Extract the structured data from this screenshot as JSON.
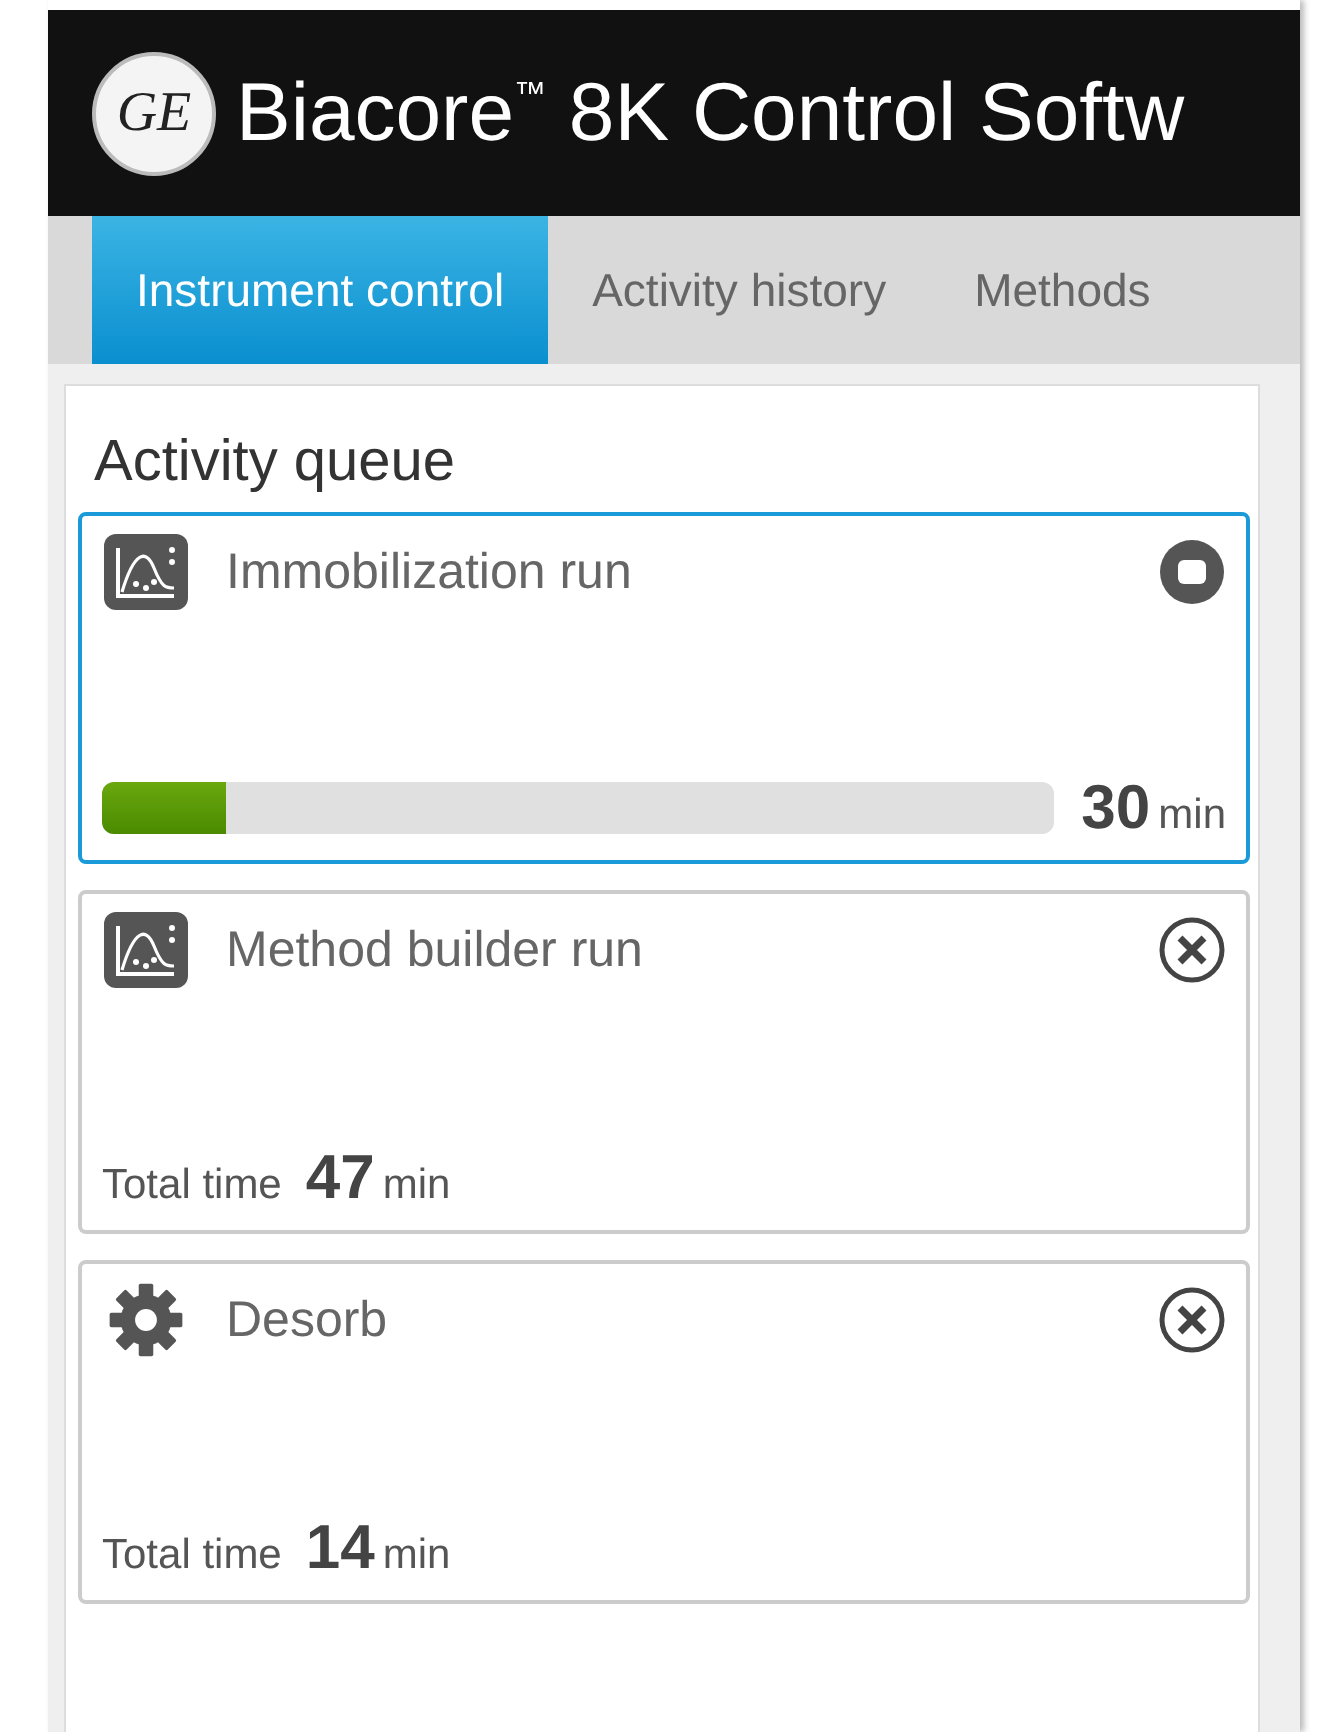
{
  "header": {
    "logo": "GE",
    "title": "Biacore$^{™}$ 8K Control Softw"
  },
  "tabs": [
    {
      "label": "Instrument control",
      "selected": true
    },
    {
      "label": "Activity history",
      "selected": false
    },
    {
      "label": "Methods",
      "selected": false
    }
  ],
  "queue": {
    "title": "Activity queue",
    "items": [
      {
        "name": "Immobilization run",
        "kind": "run",
        "selected": true,
        "level": 0.13,
        "time": "30",
        "unit": "min"
      },
      {
        "name": "Method builder run",
        "kind": "run",
        "selected": false,
        "label": "Total time",
        "time": "47",
        "unit": "min"
      },
      {
        "name": "Desorb",
        "kind": "task",
        "selected": false,
        "label": "Total time",
        "time": "14",
        "unit": "min"
      }
    ]
  }
}
